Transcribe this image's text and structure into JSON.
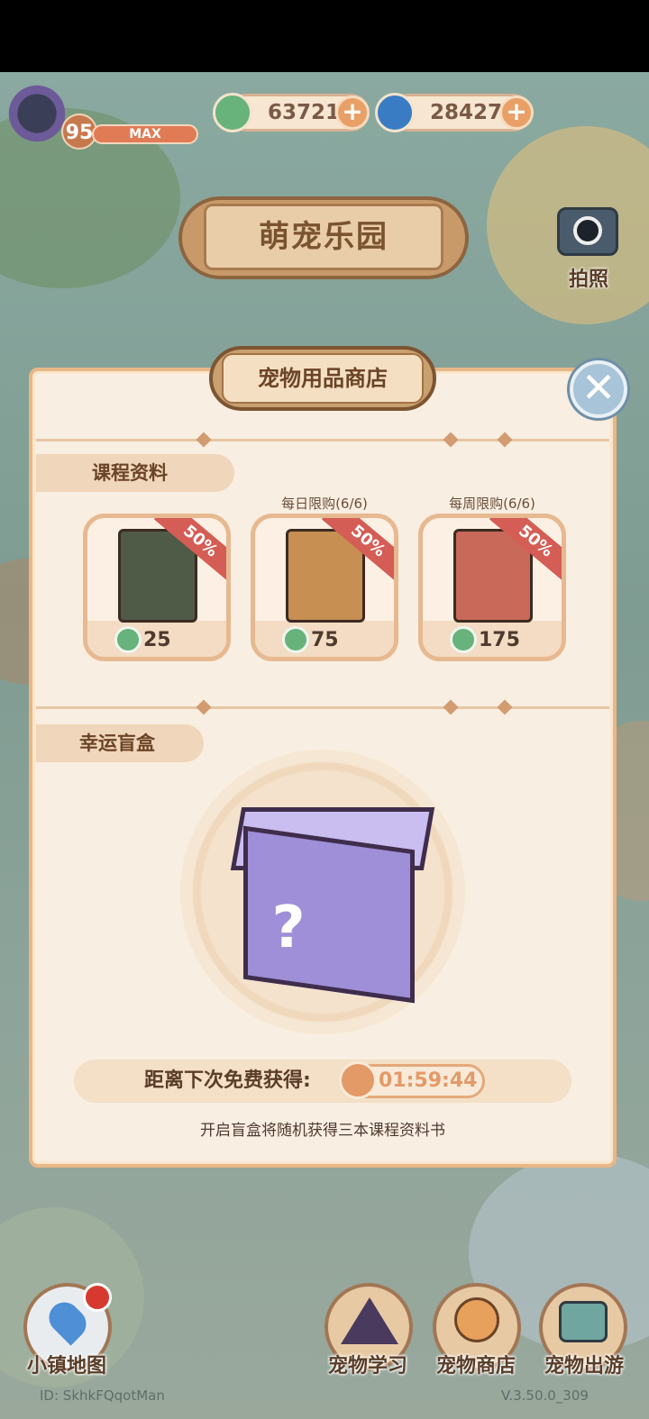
{
  "player": {
    "level": "95",
    "level_status": "MAX"
  },
  "currencies": [
    {
      "icon": "clover-icon",
      "amount": "63721",
      "color": "#68b27c"
    },
    {
      "icon": "swirl-icon",
      "amount": "28427",
      "color": "#3a7cc4"
    }
  ],
  "park_title": "萌宠乐园",
  "camera_label": "拍照",
  "shop": {
    "title": "宠物用品商店",
    "course_section": "课程资料",
    "items": [
      {
        "limit": "",
        "price": "25",
        "discount": "50%",
        "book_color": "#4f5a47"
      },
      {
        "limit": "每日限购(6/6)",
        "price": "75",
        "discount": "50%",
        "book_color": "#c78f52"
      },
      {
        "limit": "每周限购(6/6)",
        "price": "175",
        "discount": "50%",
        "book_color": "#c9695a"
      }
    ],
    "blindbox_section": "幸运盲盒",
    "timer_label": "距离下次免费获得:",
    "timer_value": "01:59:44",
    "hint": "开启盲盒将随机获得三本课程资料书"
  },
  "nav": [
    {
      "label": "小镇地图",
      "icon": "map-pin-icon"
    },
    {
      "label": "宠物学习",
      "icon": "wizard-hat-icon"
    },
    {
      "label": "宠物商店",
      "icon": "shiba-dog-icon"
    },
    {
      "label": "宠物出游",
      "icon": "suitcase-icon"
    }
  ],
  "footer": {
    "id_text": "ID:  SkhkFQqotMan",
    "version": "V.3.50.0_309"
  }
}
